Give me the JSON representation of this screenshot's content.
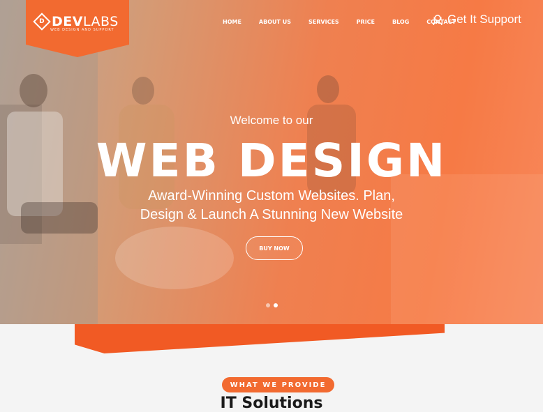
{
  "brand": {
    "name_bold": "DEV",
    "name_thin": "LABS",
    "tagline": "WEB DESIGN AND SUPPORT"
  },
  "nav": {
    "items": [
      "HOME",
      "ABOUT US",
      "SERVICES",
      "PRICE",
      "BLOG",
      "CONTACT"
    ]
  },
  "support": {
    "label": "Get It Support",
    "icon": "support-agent-icon"
  },
  "hero": {
    "welcome": "Welcome to our",
    "headline": "WEB DESIGN",
    "subline1": "Award-Winning Custom Websites. Plan,",
    "subline2": "Design & Launch A Stunning New Website",
    "cta": "BUY NOW",
    "slides_total": 2,
    "slide_active": 2
  },
  "section": {
    "badge": "WHAT WE PROVIDE",
    "title": "IT Solutions"
  },
  "colors": {
    "accent": "#f26a30",
    "accent_dark": "#f15a24",
    "text_light": "#ffffff"
  }
}
